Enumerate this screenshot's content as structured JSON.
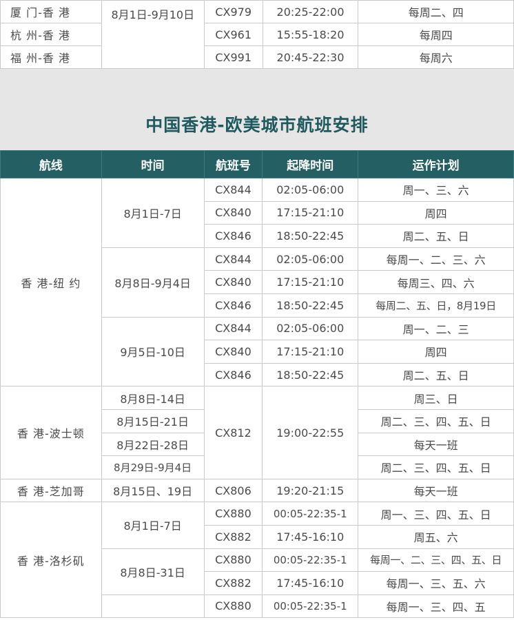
{
  "top_rows": [
    {
      "route": "厦 门-香 港",
      "date": "8月1日-9月10日",
      "flight": "CX979",
      "time": "20:25-22:00",
      "plan": "每周二、四"
    },
    {
      "route": "杭 州-香 港",
      "flight": "CX961",
      "time": "15:55-18:20",
      "plan": "每周四"
    },
    {
      "route": "福 州-香 港",
      "flight": "CX991",
      "time": "20:45-22:30",
      "plan": "每周六"
    }
  ],
  "section_title": "中国香港-欧美城市航班安排",
  "headers": {
    "route": "航线",
    "date": "时间",
    "flight": "航班号",
    "time": "起降时间",
    "plan": "运作计划"
  },
  "ny": {
    "route": "香 港-纽 约",
    "groups": [
      {
        "date": "8月1日-7日",
        "rows": [
          {
            "flight": "CX844",
            "time": "02:05-06:00",
            "plan": "周一、三、六"
          },
          {
            "flight": "CX840",
            "time": "17:15-21:10",
            "plan": "周四"
          },
          {
            "flight": "CX846",
            "time": "18:50-22:45",
            "plan": "周二、五、日"
          }
        ]
      },
      {
        "date": "8月8日-9月4日",
        "rows": [
          {
            "flight": "CX844",
            "time": "02:05-06:00",
            "plan": "每周一、二、三、六"
          },
          {
            "flight": "CX840",
            "time": "17:15-21:10",
            "plan": "每周三、四、六"
          },
          {
            "flight": "CX846",
            "time": "18:50-22:45",
            "plan": "每周二、五、日，8月19日"
          }
        ]
      },
      {
        "date": "9月5日-10日",
        "rows": [
          {
            "flight": "CX844",
            "time": "02:05-06:00",
            "plan": "周一、二、三"
          },
          {
            "flight": "CX840",
            "time": "17:15-21:10",
            "plan": "周四"
          },
          {
            "flight": "CX846",
            "time": "18:50-22:45",
            "plan": "周二、五、日"
          }
        ]
      }
    ]
  },
  "boston": {
    "route": "香 港-波士顿",
    "flight": "CX812",
    "time": "19:00-22:55",
    "rows": [
      {
        "date": "8月8日-14日",
        "plan": "周三、日"
      },
      {
        "date": "8月15日-21日",
        "plan": "周二、三、四、五、日"
      },
      {
        "date": "8月22日-28日",
        "plan": "每天一班"
      },
      {
        "date": "8月29日-9月4日",
        "plan": "周二、三、四、五、日"
      }
    ]
  },
  "chicago": {
    "route": "香 港-芝加哥",
    "date": "8月15日、19日",
    "flight": "CX806",
    "time": "19:20-21:15",
    "plan": "每天一班"
  },
  "la": {
    "route": "香 港-洛杉矶",
    "groups": [
      {
        "date": "8月1日-7日",
        "rows": [
          {
            "flight": "CX880",
            "time": "00:05-22:35-1",
            "plan": "周一、三、四、五、日"
          },
          {
            "flight": "CX882",
            "time": "17:45-16:10",
            "plan": "周五、六"
          }
        ]
      },
      {
        "date": "8月8日-31日",
        "rows": [
          {
            "flight": "CX880",
            "time": "00:05-22:35-1",
            "plan": "每周一、二、三、四、五、日"
          },
          {
            "flight": "CX882",
            "time": "17:45-16:10",
            "plan": "每周一、三、五、六"
          }
        ]
      },
      {
        "date": "",
        "rows": [
          {
            "flight": "CX880",
            "time": "00:05-22:35-1",
            "plan": "每周一、三、四、五"
          }
        ]
      }
    ]
  }
}
